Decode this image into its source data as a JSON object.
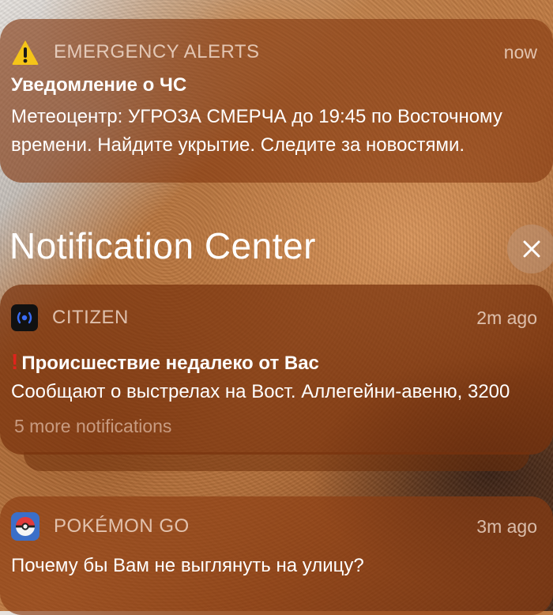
{
  "emergency": {
    "app_name": "EMERGENCY ALERTS",
    "time": "now",
    "title": "Уведомление о ЧС",
    "body": "Метеоцентр: УГРОЗА СМЕРЧА до 19:45 по Восточному времени. Найдите укрытие. Следите за новостями.",
    "icon": "warning-triangle-icon"
  },
  "notification_center": {
    "title": "Notification Center",
    "close_icon": "close-icon"
  },
  "citizen": {
    "app_name": "CITIZEN",
    "time": "2m ago",
    "title_prefix": "!",
    "title": "Происшествие недалеко от Вас",
    "body": "Сообщают о выстрелах на Вост. Аллегейни-авеню, 3200",
    "more": "5 more notifications",
    "icon": "citizen-broadcast-icon"
  },
  "pokemon": {
    "app_name": "POKÉMON GO",
    "time": "3m ago",
    "body": "Почему бы Вам не выглянуть на улицу?",
    "icon": "pokeball-icon"
  },
  "colors": {
    "card_tint": "#82370f",
    "alert_red": "#e0241c",
    "warning_yellow": "#f5c518"
  }
}
